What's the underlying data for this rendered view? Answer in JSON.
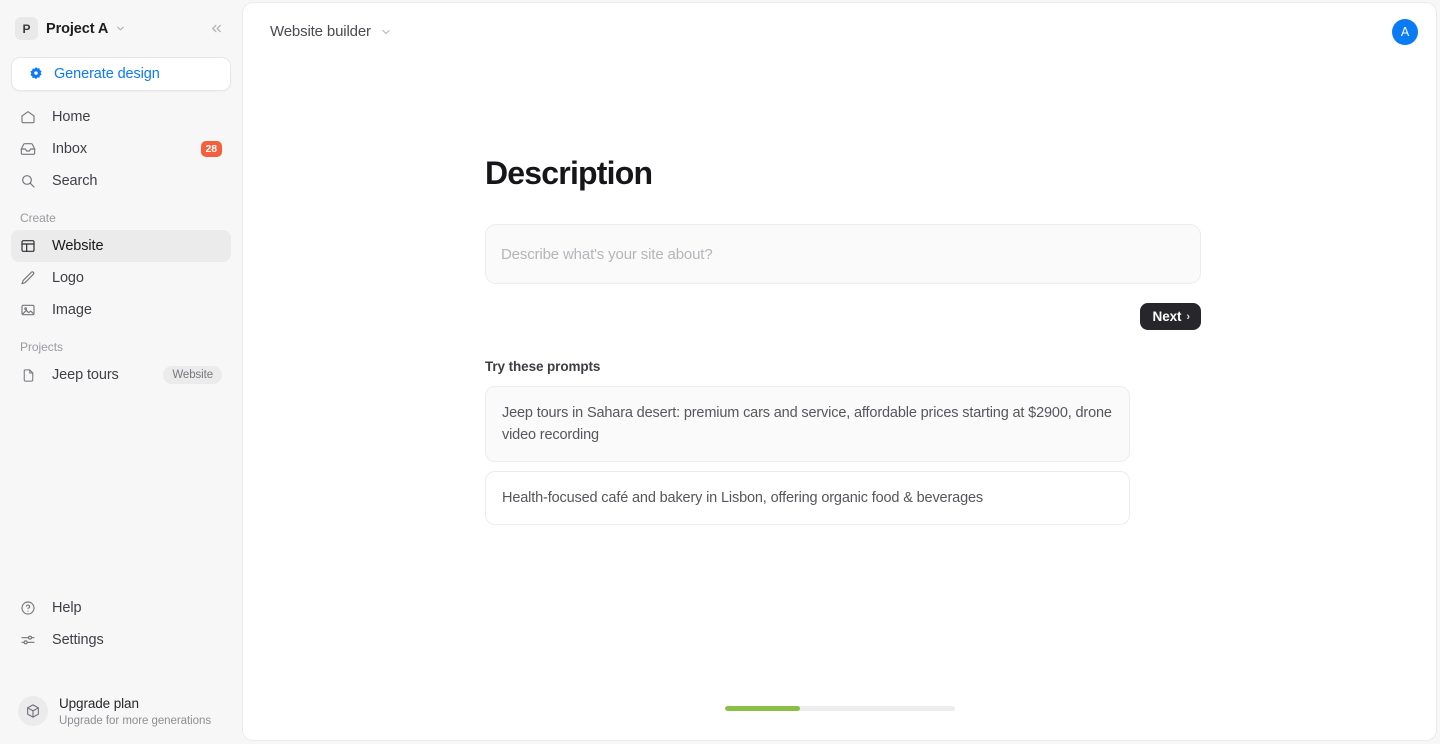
{
  "sidebar": {
    "project": {
      "initial": "P",
      "name": "Project A",
      "caret_icon": "chevron-down-icon"
    },
    "collapse_icon": "collapse-sidebar-icon",
    "generate": {
      "label": "Generate design",
      "icon": "sparkle-gear-icon",
      "color": "#0b7bf5"
    },
    "nav": [
      {
        "label": "Home",
        "icon": "home-icon",
        "active": false
      },
      {
        "label": "Inbox",
        "icon": "inbox-icon",
        "active": false,
        "badge": "28",
        "badge_color": "#f4603e"
      },
      {
        "label": "Search",
        "icon": "search-icon",
        "active": false
      }
    ],
    "create_group": {
      "title": "Create",
      "items": [
        {
          "label": "Website",
          "icon": "layout-panel-icon",
          "active": true
        },
        {
          "label": "Logo",
          "icon": "pencil-icon",
          "active": false
        },
        {
          "label": "Image",
          "icon": "image-icon",
          "active": false
        }
      ]
    },
    "projects_group": {
      "title": "Projects",
      "items": [
        {
          "label": "Jeep tours",
          "icon": "document-icon",
          "tag": "Website"
        }
      ]
    },
    "footer_nav": [
      {
        "label": "Help",
        "icon": "help-circle-icon"
      },
      {
        "label": "Settings",
        "icon": "sliders-icon"
      }
    ],
    "upgrade": {
      "title": "Upgrade plan",
      "subtitle": "Upgrade for more generations",
      "icon": "cube-icon"
    }
  },
  "header": {
    "breadcrumb": "Website builder",
    "caret_icon": "chevron-down-icon",
    "avatar": {
      "initial": "A",
      "color": "#0b7bf5"
    }
  },
  "main": {
    "title": "Description",
    "description_input": {
      "value": "",
      "placeholder": "Describe what's your site about?"
    },
    "next_button": {
      "label": "Next",
      "chevron": "›"
    },
    "prompts_title": "Try these prompts",
    "prompts": [
      {
        "text": "Jeep tours in Sahara desert: premium cars and service, affordable prices starting at $2900, drone video recording",
        "hovered": true
      },
      {
        "text": "Health-focused café and bakery in Lisbon, offering organic food & beverages",
        "hovered": false
      }
    ],
    "progress": {
      "percent": 33,
      "fill_color": "#8cbf45",
      "track_color": "#ededee"
    }
  }
}
